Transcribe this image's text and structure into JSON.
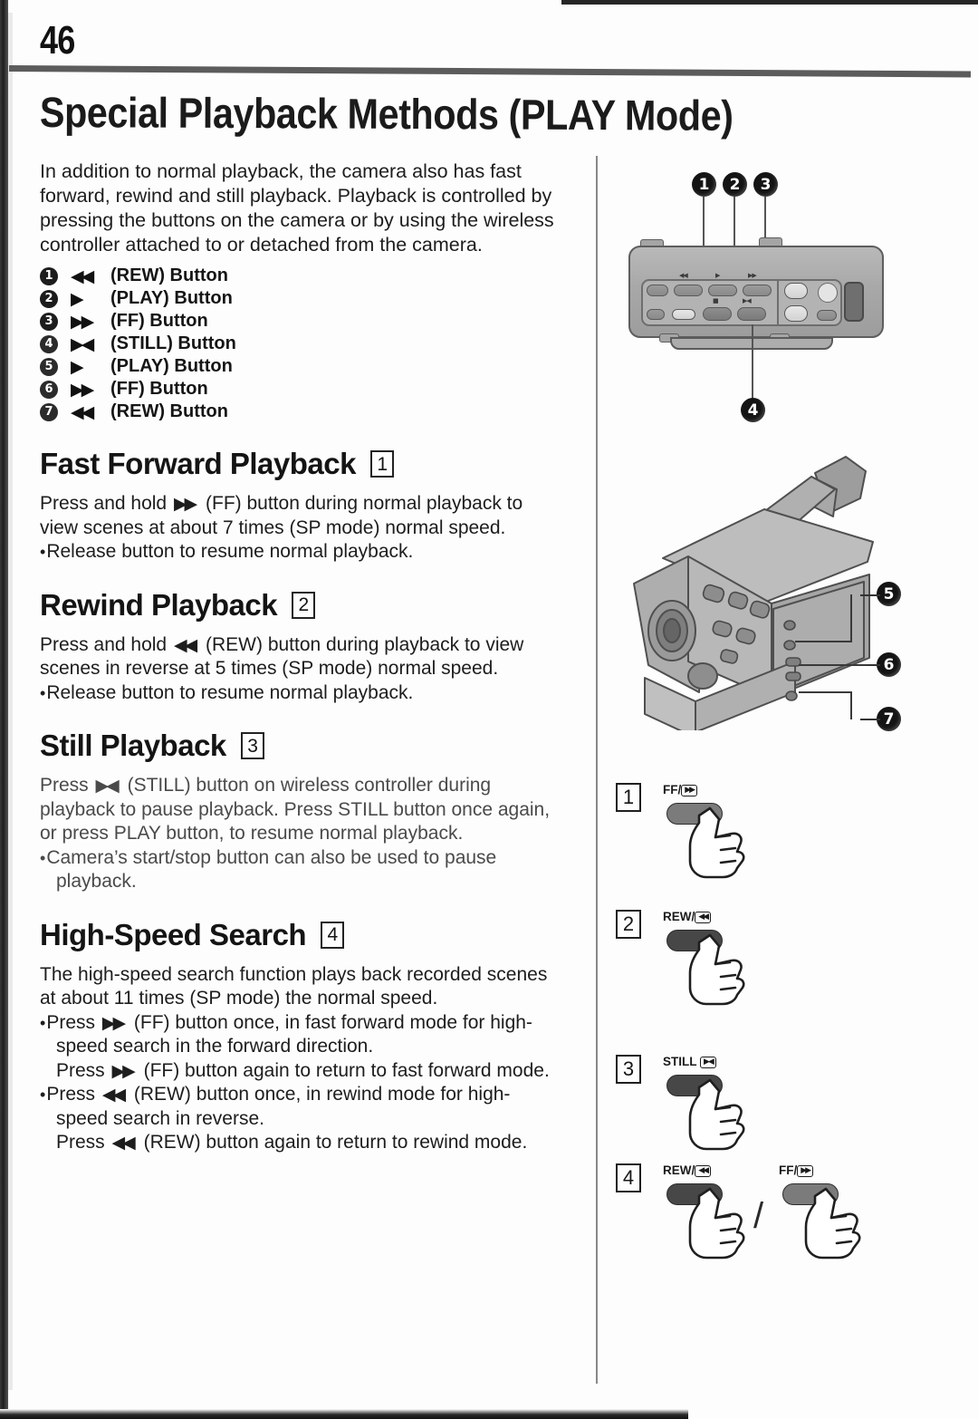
{
  "page": {
    "number": "46",
    "title": "Special Playback Methods (PLAY Mode)"
  },
  "intro": {
    "text": "In addition to normal playback, the camera also has fast forward, rewind and still playback. Playback is controlled by pressing the buttons on the camera or by using the wireless controller attached to or detached from the camera."
  },
  "button_list": [
    {
      "num": "1",
      "glyph": "◀◀",
      "label": "(REW) Button"
    },
    {
      "num": "2",
      "glyph": "▶",
      "label": "(PLAY) Button"
    },
    {
      "num": "3",
      "glyph": "▶▶",
      "label": "(FF) Button"
    },
    {
      "num": "4",
      "glyph": "▶◀",
      "label": "(STILL) Button"
    },
    {
      "num": "5",
      "glyph": "▶",
      "label": "(PLAY) Button"
    },
    {
      "num": "6",
      "glyph": "▶▶",
      "label": "(FF) Button"
    },
    {
      "num": "7",
      "glyph": "◀◀",
      "label": "(REW) Button"
    }
  ],
  "sections": [
    {
      "id": "fast-forward-playback",
      "heading": "Fast Forward Playback",
      "boxnum": "1",
      "lines": [
        {
          "kind": "run",
          "pre": "Press and hold",
          "glyph": "▶▶",
          "post": "(FF) button during normal playback to"
        },
        {
          "kind": "plain",
          "text": "view scenes at about 7 times (SP mode) normal speed."
        },
        {
          "kind": "bullet",
          "text": "Release button to resume normal playback."
        }
      ]
    },
    {
      "id": "rewind-playback",
      "heading": "Rewind Playback",
      "boxnum": "2",
      "lines": [
        {
          "kind": "run",
          "pre": "Press and hold",
          "glyph": "◀◀",
          "post": "(REW) button during playback to view"
        },
        {
          "kind": "plain",
          "text": "scenes in reverse at 5 times (SP mode) normal speed."
        },
        {
          "kind": "bullet",
          "text": "Release button to resume normal playback."
        }
      ]
    },
    {
      "id": "still-playback",
      "heading": "Still Playback",
      "boxnum": "3",
      "lines": [
        {
          "kind": "run",
          "pre": "Press",
          "glyph": "▶◀",
          "post": "(STILL) button on wireless controller during"
        },
        {
          "kind": "plain",
          "text": "playback to pause playback. Press STILL button once again,"
        },
        {
          "kind": "plain",
          "text": "or press PLAY button, to resume normal playback."
        },
        {
          "kind": "bullet",
          "text": "Camera’s start/stop button can also be used to pause"
        },
        {
          "kind": "indent",
          "text": "playback."
        }
      ]
    },
    {
      "id": "high-speed-search",
      "heading": "High-Speed Search",
      "boxnum": "4",
      "lines": [
        {
          "kind": "plain",
          "text": "The high-speed search function plays back recorded scenes"
        },
        {
          "kind": "plain",
          "text": "at about 11 times (SP mode) the normal speed."
        },
        {
          "kind": "bullet-run",
          "pre": "Press",
          "glyph": "▶▶",
          "post": "(FF) button once, in fast forward mode for high-"
        },
        {
          "kind": "indent",
          "text": "speed search in the forward direction."
        },
        {
          "kind": "indent-run",
          "pre": "Press",
          "glyph": "▶▶",
          "post": "(FF) button again to return to fast forward mode."
        },
        {
          "kind": "bullet-run",
          "pre": "Press",
          "glyph": "◀◀",
          "post": "(REW) button once, in rewind mode for high-"
        },
        {
          "kind": "indent",
          "text": "speed search in reverse."
        },
        {
          "kind": "indent-run",
          "pre": "Press",
          "glyph": "◀◀",
          "post": "(REW) button again to return to rewind mode."
        }
      ]
    }
  ],
  "figures": {
    "camera_top": {
      "name": "camera-top-panel-diagram",
      "callouts": [
        "1",
        "2",
        "3",
        "4"
      ],
      "key_labels": [
        "REW",
        "PLAY",
        "FF",
        "STOP",
        "STILL"
      ]
    },
    "camcorder": {
      "name": "camcorder-side-view-diagram",
      "callouts": [
        "5",
        "6",
        "7"
      ]
    },
    "press_steps": [
      {
        "boxnum": "1",
        "buttons": [
          {
            "label": "FF/",
            "icon": "▶▶",
            "style": "grey"
          }
        ]
      },
      {
        "boxnum": "2",
        "buttons": [
          {
            "label": "REW/",
            "icon": "◀◀",
            "style": "dark"
          }
        ]
      },
      {
        "boxnum": "3",
        "buttons": [
          {
            "label": "STILL ",
            "icon": "▶◀",
            "style": "dark"
          }
        ]
      },
      {
        "boxnum": "4",
        "buttons": [
          {
            "label": "REW/",
            "icon": "◀◀",
            "style": "dark"
          },
          {
            "label": "FF/",
            "icon": "▶▶",
            "style": "grey"
          }
        ],
        "separator": "/"
      }
    ]
  },
  "colors": {
    "ink": "#1a1a1a",
    "rule": "#5c5c5c",
    "callout_bg": "#141414",
    "paper": "#fdfdfd"
  }
}
